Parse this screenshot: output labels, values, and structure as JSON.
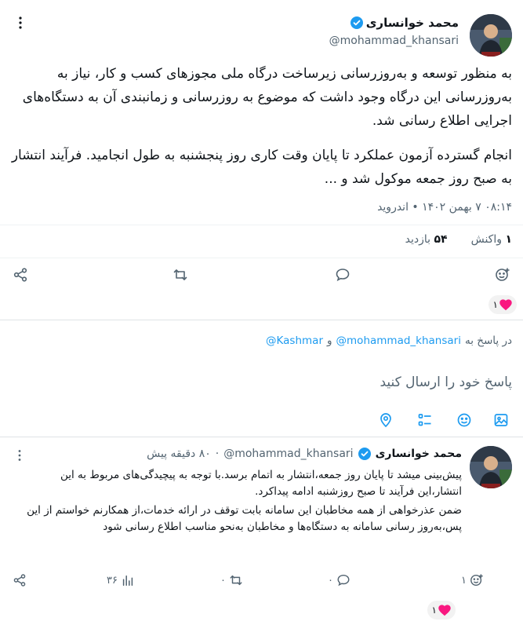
{
  "main_tweet": {
    "author_name": "محمد خوانساری",
    "author_handle": "@mohammad_khansari",
    "paragraph1": "به منظور توسعه و به‌روزرسانی زیرساخت درگاه ملی مجوزهای کسب و کار، نیاز به به‌روزرسانی این درگاه وجود داشت که موضوع به روزرسانی و زمانبندی آن به دستگاه‌های اجرایی اطلاع رسانی شد.",
    "paragraph2": "انجام گسترده آزمون عملکرد تا پایان وقت کاری روز پنجشنبه به طول انجامید. فرآیند انتشار به صبح روز جمعه موکول شد و ...",
    "timestamp": "۰۸:۱۴ ۷ بهمن ۱۴۰۲ • اندروید",
    "reactions_count": "۱",
    "reactions_label": "واکنش",
    "views_count": "۵۴",
    "views_label": "بازدید",
    "heart_badge_count": "۱"
  },
  "reply_composer": {
    "replying_prefix": "در پاسخ به",
    "reply_handle1": "@mohammad_khansari",
    "reply_and": "و",
    "reply_handle2": "@Kashmar",
    "placeholder": "پاسخ خود را ارسال کنید"
  },
  "reply_tweet": {
    "author_name": "محمد خوانساری",
    "author_handle": "@mohammad_khansari",
    "time": "۸۰ دقیقه پیش",
    "line1": "پیش‌بینی میشد تا پایان روز جمعه،انتشار به اتمام برسد.با توجه به پیچیدگی‌های مربوط به این انتشار،این فرآیند تا صبح روزشنبه ادامه پیداکرد.",
    "line2": "ضمن عذرخواهی از همه مخاطبان این سامانه بابت توقف در ارائه خدمات،از همکارنم خواستم از این پس،به‌روز رسانی سامانه به دستگاه‌ها و مخاطبان به‌نحو مناسب اطلاع رسانی شود",
    "reactions_count": "۱",
    "comments_count": "۰",
    "retweets_count": "۰",
    "views_count": "۳۶",
    "heart_badge_count": "۱"
  },
  "icons": {
    "more": "more-vertical-icon",
    "verified": "verified-badge-icon",
    "share": "share-icon",
    "retweet": "retweet-icon",
    "comment": "comment-icon",
    "add_reaction": "add-reaction-icon",
    "heart": "heart-icon",
    "location": "location-icon",
    "poll": "poll-icon",
    "emoji": "emoji-icon",
    "image": "image-icon",
    "views": "views-icon"
  },
  "colors": {
    "accent": "#1d9bf0",
    "heart": "#f91880",
    "muted": "#536471"
  }
}
